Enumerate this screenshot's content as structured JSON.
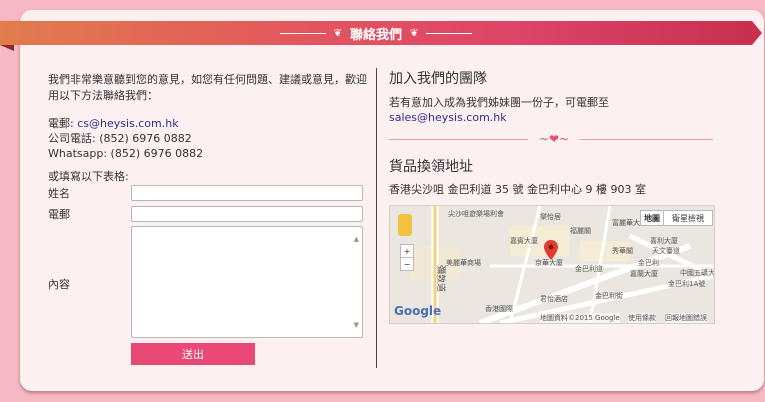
{
  "header": {
    "title": "聯絡我們"
  },
  "contact_section": {
    "intro": "我們非常樂意聽到您的意見，如您有任何問題、建議或意見，歡迎用以下方法聯絡我們：",
    "email_label": "電郵: ",
    "email": "cs@heysis.com.hk",
    "phone": "公司電話: (852) 6976 0882",
    "whatsapp": "Whatsapp: (852) 6976 0882",
    "form_hint": "或填寫以下表格:"
  },
  "form": {
    "name_label": "姓名",
    "email_label": "電郵",
    "content_label": "內容",
    "submit_label": "送出"
  },
  "join_section": {
    "title": "加入我們的團隊",
    "text": "若有意加入成為我們姊妹團一份子，可電郵至",
    "email": "sales@heysis.com.hk"
  },
  "pickup_section": {
    "title": "貨品換領地址",
    "address": "香港尖沙咀 金巴利道 35 號 金巴利中心 9 樓 903 室"
  },
  "map": {
    "view_map": "地圖",
    "view_satellite": "衛星檢視",
    "zoom_in": "+",
    "zoom_out": "−",
    "labels": [
      "尖沙咀遊樂場利會",
      "樂怡居",
      "嘉賓大廈",
      "福麗閣",
      "富麗華大廈",
      "秀華閣",
      "天文臺道",
      "中國五礦大廈",
      "美麗華商場",
      "金巴利道",
      "金巴利街",
      "君怡酒店",
      "香港國際",
      "京華大廈",
      "喜利大廈",
      "嘉蘭大廈",
      "金巴利",
      "金巴利1A號"
    ],
    "street_nathan": "彌敦道",
    "google_logo": "Google",
    "footer_data": "地圖資料©2015 Google",
    "footer_terms": "使用條款",
    "footer_report": "回報地圖錯誤"
  },
  "colors": {
    "background": "#f6b8c2",
    "card": "#fdf0f0",
    "ribbon": "#dd4368",
    "submit": "#e84a75",
    "link": "#2b2f8f"
  }
}
